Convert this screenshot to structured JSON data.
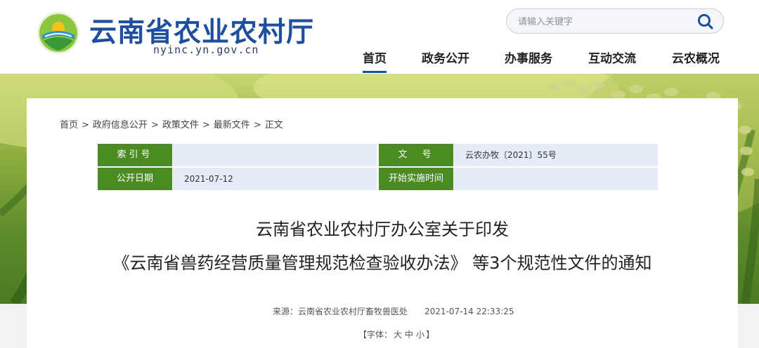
{
  "header": {
    "site_title": "云南省农业农村厅",
    "site_domain": "nyinc.yn.gov.cn",
    "search": {
      "placeholder": "请输入关键字"
    },
    "nav": [
      "首页",
      "政务公开",
      "办事服务",
      "互动交流",
      "云农概况"
    ],
    "accent_color": "#1e4f9c"
  },
  "breadcrumb": [
    "首页",
    "政府信息公开",
    "政策文件",
    "最新文件",
    "正文"
  ],
  "meta": {
    "index_label": "索引号",
    "index_value": "",
    "doc_no_label": "文　号",
    "doc_no_value": "云农办牧〔2021〕55号",
    "publish_label": "公开日期",
    "publish_value": "2021-07-12",
    "effective_label": "开始实施时间",
    "effective_value": "",
    "label_color": "#4a8b22"
  },
  "article": {
    "title_line1": "云南省农业农村厅办公室关于印发",
    "title_line2": "《云南省兽药经营质量管理规范检查验收办法》 等3个规范性文件的通知",
    "source_label": "来源：",
    "source": "云南省农业农村厅畜牧兽医处",
    "datetime": "2021-07-14 22:33:25",
    "fontsize_prefix": "【字体：",
    "fontsize_large": "大",
    "fontsize_medium": "中",
    "fontsize_small": "小",
    "fontsize_suffix": "】"
  }
}
